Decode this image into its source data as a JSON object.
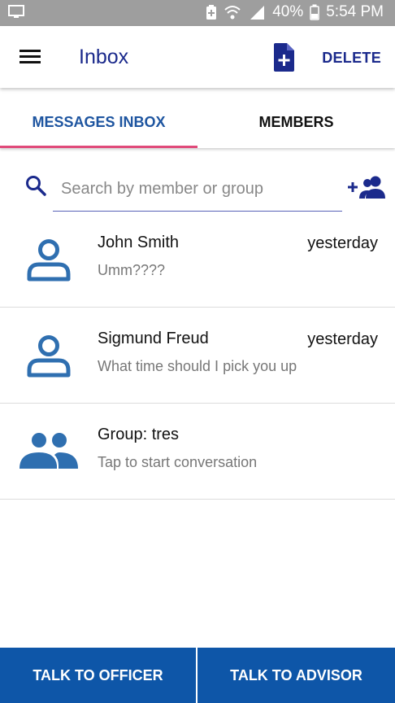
{
  "status_bar": {
    "battery": "40%",
    "time": "5:54 PM",
    "icons": [
      "screen-icon",
      "battery-saver-icon",
      "wifi-icon",
      "signal-icon",
      "battery-icon"
    ]
  },
  "app_bar": {
    "title": "Inbox",
    "delete_label": "DELETE",
    "icons": [
      "menu-icon",
      "new-message-icon"
    ]
  },
  "tabs": [
    {
      "label": "MESSAGES INBOX",
      "active": true
    },
    {
      "label": "MEMBERS",
      "active": false
    }
  ],
  "search": {
    "placeholder": "Search by member or group",
    "value": ""
  },
  "conversations": [
    {
      "name": "John Smith",
      "preview": "Umm????",
      "time": "yesterday",
      "avatar": "person-icon"
    },
    {
      "name": "Sigmund Freud",
      "preview": "What time should I pick you up",
      "time": "yesterday",
      "avatar": "person-icon"
    },
    {
      "name": "Group: tres",
      "preview": "Tap to start conversation",
      "time": "",
      "avatar": "group-icon"
    }
  ],
  "bottom_buttons": {
    "officer": "TALK TO OFFICER",
    "advisor": "TALK TO ADVISOR"
  },
  "colors": {
    "accent": "#1b2a8c",
    "tab_active": "#1e55a0",
    "tab_indicator": "#e04a7a",
    "avatar": "#2f6fb0",
    "button": "#0e56a8",
    "status_bar": "#9e9e9e"
  }
}
